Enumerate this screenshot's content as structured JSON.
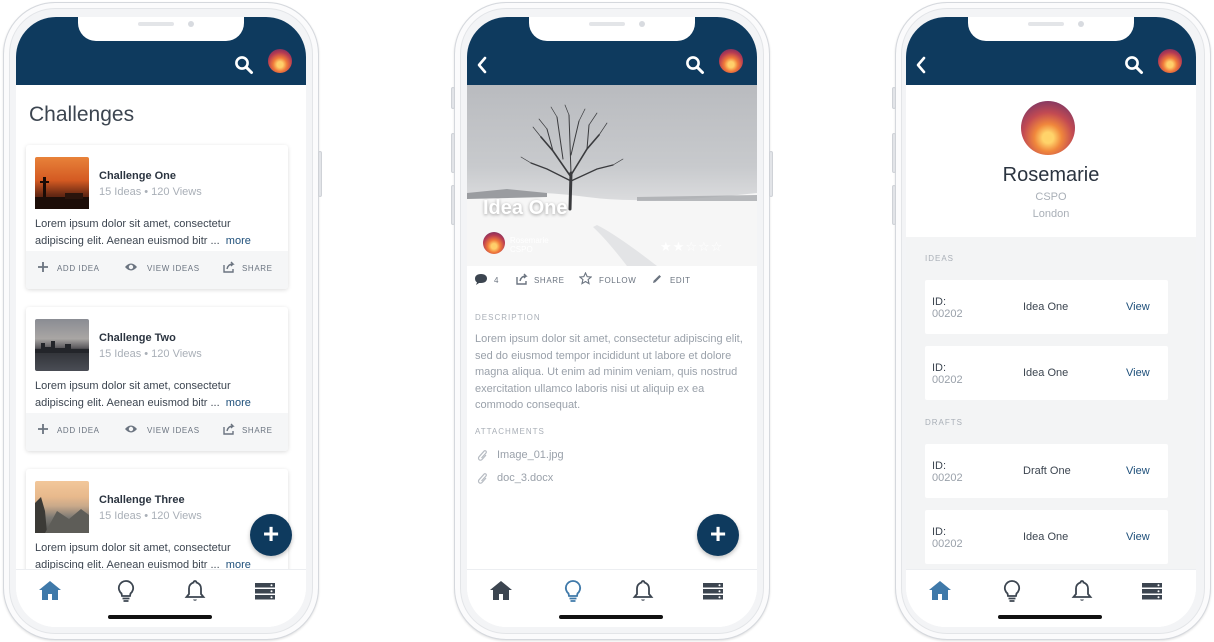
{
  "colors": {
    "brand_navy": "#0e3a5e",
    "link": "#1e4f7a",
    "muted": "#a9afb7"
  },
  "icons": {
    "search": "search-icon",
    "avatar": "avatar",
    "back": "chevron-left-icon",
    "add": "plus-icon",
    "nav": [
      "home-icon",
      "lightbulb-icon",
      "bell-icon",
      "server-icon"
    ]
  },
  "challenges_screen": {
    "title": "Challenges",
    "cards": [
      {
        "title": "Challenge One",
        "meta": "15 Ideas • 120 Views",
        "desc": "Lorem ipsum dolor sit amet, consectetur adipiscing elit. Aenean euismod bitr ...",
        "more": "more"
      },
      {
        "title": "Challenge Two",
        "meta": "15 Ideas • 120 Views",
        "desc": "Lorem ipsum dolor sit amet, consectetur adipiscing elit. Aenean euismod bitr ...",
        "more": "more"
      },
      {
        "title": "Challenge Three",
        "meta": "15 Ideas • 120 Views",
        "desc": "Lorem ipsum dolor sit amet, consectetur adipiscing elit. Aenean euismod bitr ...",
        "more": "more"
      }
    ],
    "actions": {
      "add_idea": "ADD IDEA",
      "view_ideas": "VIEW IDEAS",
      "share": "SHARE"
    },
    "fab": "+"
  },
  "idea_screen": {
    "title": "Idea One",
    "author_name": "Rosemarie",
    "author_role": "CSPO",
    "rating": 2,
    "rating_max": 5,
    "comments_count": "4",
    "actions": {
      "share": "SHARE",
      "follow": "FOLLOW",
      "edit": "EDIT"
    },
    "description_label": "DESCRIPTION",
    "description": "Lorem ipsum dolor sit amet, consectetur adipiscing elit, sed do eiusmod tempor incididunt ut labore et dolore magna aliqua. Ut enim ad minim veniam, quis nostrud exercitation ullamco laboris nisi ut aliquip ex ea commodo consequat.",
    "attachments_label": "ATTACHMENTS",
    "attachments": [
      "Image_01.jpg",
      "doc_3.docx"
    ],
    "fab": "+"
  },
  "profile_screen": {
    "name": "Rosemarie",
    "role": "CSPO",
    "location": "London",
    "ideas_label": "IDEAS",
    "drafts_label": "DRAFTS",
    "ideas": [
      {
        "id_label": "ID:",
        "id": "00202",
        "name": "Idea One",
        "action": "View"
      },
      {
        "id_label": "ID:",
        "id": "00202",
        "name": "Idea One",
        "action": "View"
      }
    ],
    "drafts": [
      {
        "id_label": "ID:",
        "id": "00202",
        "name": "Draft One",
        "action": "View"
      },
      {
        "id_label": "ID:",
        "id": "00202",
        "name": "Idea One",
        "action": "View"
      }
    ]
  }
}
